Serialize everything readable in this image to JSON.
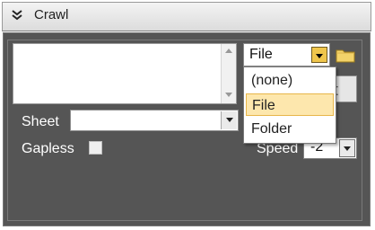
{
  "window": {
    "title": "Crawl",
    "collapse_icon": "double-chevron-icon"
  },
  "textarea": {
    "value": ""
  },
  "file_combo": {
    "selected": "File",
    "options": [
      "(none)",
      "File",
      "Folder"
    ],
    "highlighted": "File"
  },
  "folder_button": {
    "icon": "folder-icon"
  },
  "hidden_button": {
    "label": "t"
  },
  "sheet": {
    "label": "Sheet",
    "value": ""
  },
  "gapless": {
    "label": "Gapless",
    "checked": false
  },
  "speed": {
    "label": "Speed",
    "value": "-2"
  },
  "colors": {
    "panel_bg": "#555555",
    "combo_button": "#f0c64c",
    "highlight": "#fde7ad"
  }
}
